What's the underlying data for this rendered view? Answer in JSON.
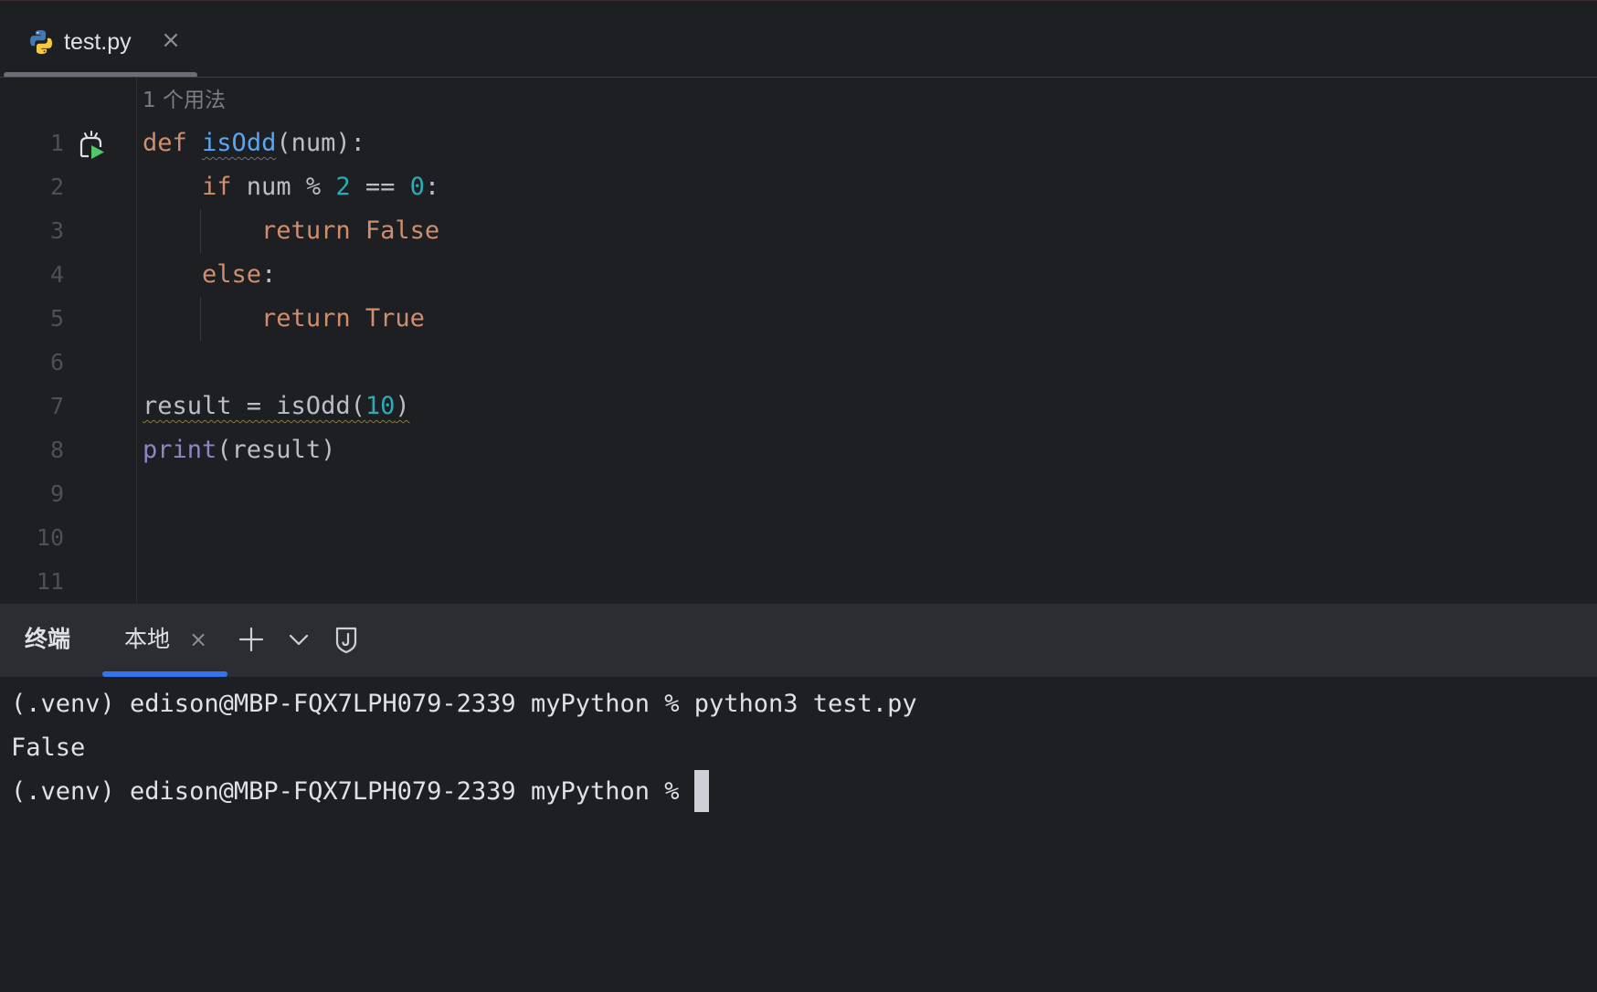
{
  "tab": {
    "filename": "test.py",
    "close_symbol": "×"
  },
  "editor": {
    "usage_hint": "1 个用法",
    "line_numbers": [
      "1",
      "2",
      "3",
      "4",
      "5",
      "6",
      "7",
      "8",
      "9",
      "10",
      "11"
    ],
    "lines": {
      "l1": {
        "kw": "def",
        "fn": "isOdd",
        "rest": "(num):"
      },
      "l2": {
        "kw": "if",
        "mid": " num % ",
        "n1": "2",
        "op": " == ",
        "n2": "0",
        "end": ":"
      },
      "l3": {
        "kw": "return",
        "val": "False"
      },
      "l4": {
        "kw": "else",
        "end": ":"
      },
      "l5": {
        "kw": "return",
        "val": "True"
      },
      "l7": {
        "pre": "result = isOdd(",
        "num": "10",
        "post": ")"
      },
      "l8": {
        "builtin": "print",
        "rest": "(result)"
      }
    }
  },
  "terminal": {
    "title": "终端",
    "tab_label": "本地",
    "close_symbol": "×",
    "output": [
      "(.venv) edison@MBP-FQX7LPH079-2339 myPython % python3 test.py",
      "False",
      "(.venv) edison@MBP-FQX7LPH079-2339 myPython % "
    ]
  },
  "colors": {
    "keyword": "#cf8e6d",
    "function": "#56a8f5",
    "number": "#2aacb8",
    "builtin": "#8888c6",
    "accent": "#3574f0",
    "background": "#1e1f22"
  },
  "icons": {
    "tab": "python-file-icon",
    "run": "run-gutter-icon",
    "new_tab": "plus-icon",
    "dropdown": "chevron-down-icon",
    "shield": "shield-icon"
  }
}
